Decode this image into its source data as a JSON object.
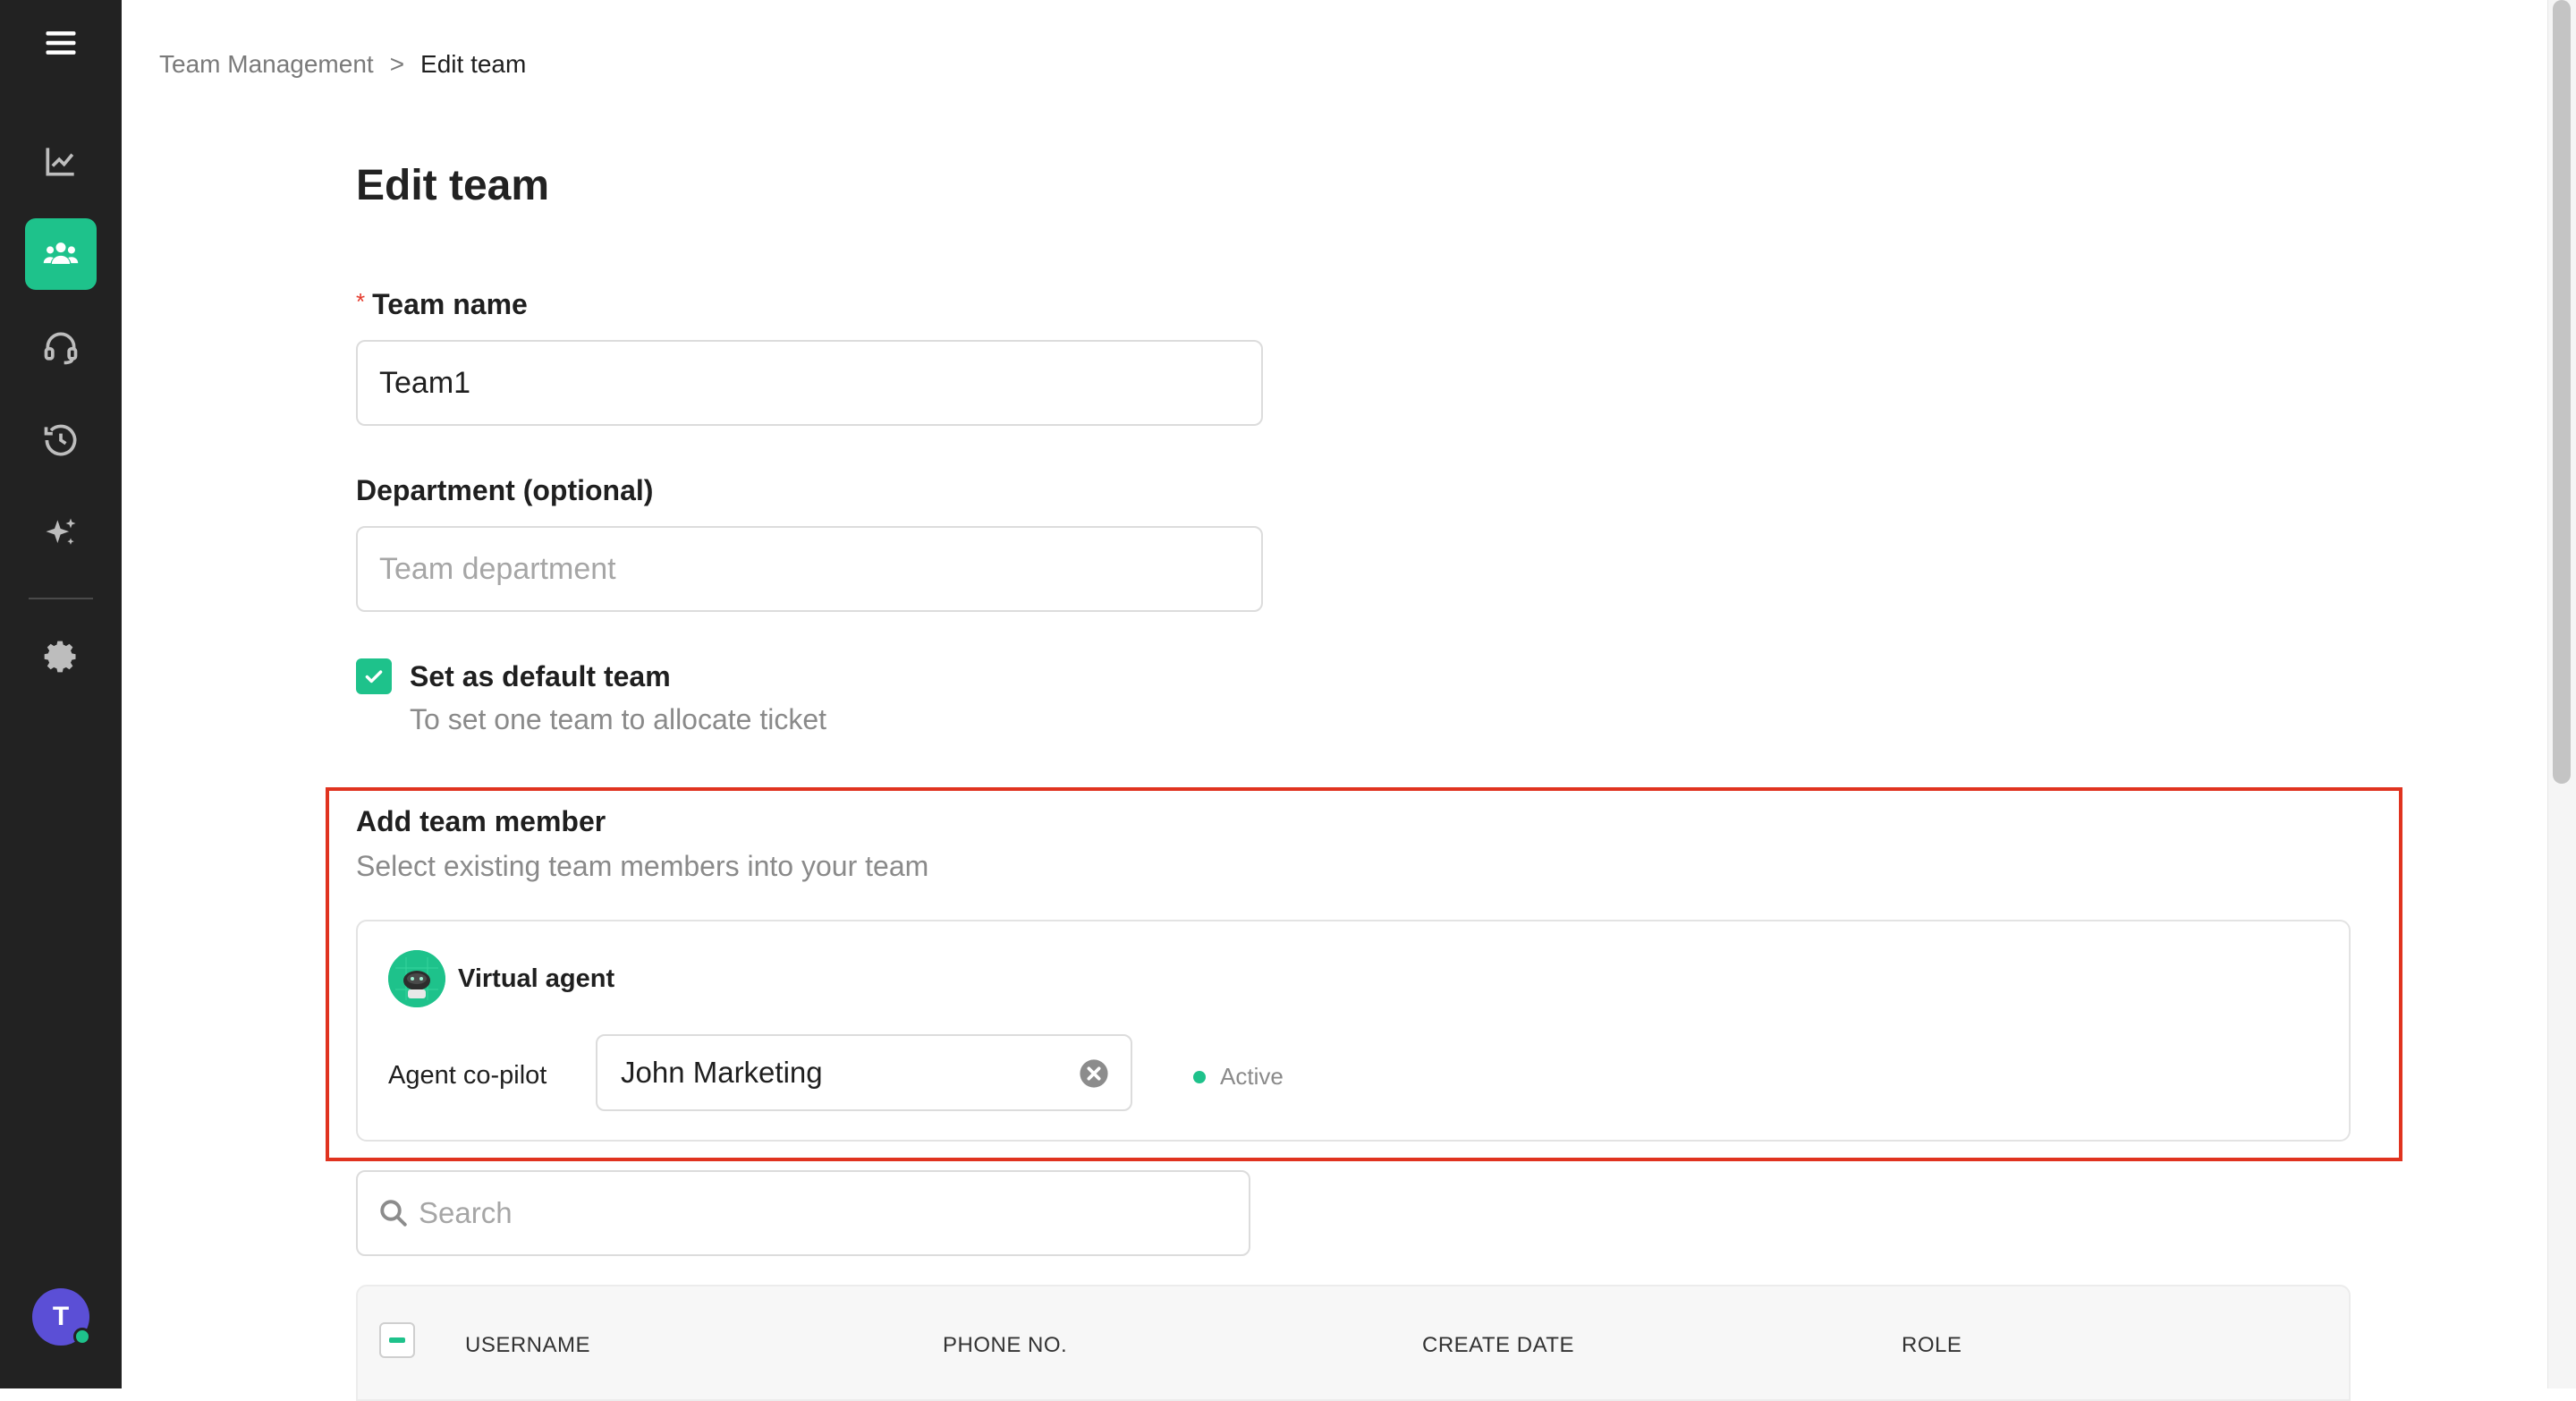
{
  "sidebar": {
    "items": [
      {
        "name": "menu",
        "icon": "hamburger-icon",
        "active": false
      },
      {
        "name": "analytics",
        "icon": "chart-line-icon",
        "active": false
      },
      {
        "name": "team",
        "icon": "users-icon",
        "active": true
      },
      {
        "name": "support",
        "icon": "headset-icon",
        "active": false
      },
      {
        "name": "history",
        "icon": "history-icon",
        "active": false
      },
      {
        "name": "ai",
        "icon": "sparkles-icon",
        "active": false
      },
      {
        "name": "settings",
        "icon": "gear-icon",
        "active": false
      }
    ],
    "avatar_initial": "T"
  },
  "breadcrumb": {
    "parent": "Team Management",
    "separator": ">",
    "current": "Edit team"
  },
  "page_title": "Edit team",
  "form": {
    "team_name": {
      "label": "Team name",
      "required_mark": "*",
      "value": "Team1"
    },
    "department": {
      "label": "Department (optional)",
      "placeholder": "Team department",
      "value": ""
    },
    "default_team": {
      "checked": true,
      "label": "Set as default team",
      "help": "To set one team to allocate ticket"
    }
  },
  "add_member": {
    "title": "Add team member",
    "subtitle": "Select existing team members into your team",
    "virtual_agent": {
      "name": "Virtual agent",
      "copilot_label": "Agent co-pilot",
      "copilot_value": "John Marketing",
      "status": "Active"
    }
  },
  "search": {
    "placeholder": "Search"
  },
  "table": {
    "columns": [
      "USERNAME",
      "PHONE NO.",
      "CREATE DATE",
      "ROLE"
    ]
  },
  "colors": {
    "accent": "#1ec28b",
    "sidebar_bg": "#222222",
    "highlight": "#e0331f",
    "avatar": "#5b4fd6"
  }
}
